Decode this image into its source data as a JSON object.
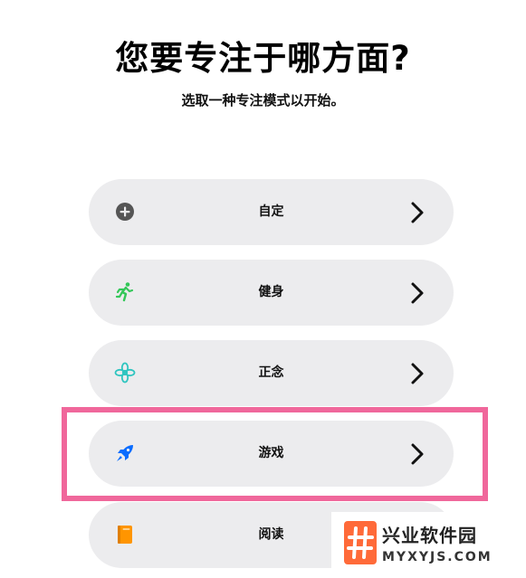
{
  "header": {
    "title": "您要专注于哪方面?",
    "subtitle": "选取一种专注模式以开始。"
  },
  "options": [
    {
      "label": "自定",
      "icon": "plus-circle-icon",
      "color": "#555555"
    },
    {
      "label": "健身",
      "icon": "running-figure-icon",
      "color": "#34c759"
    },
    {
      "label": "正念",
      "icon": "flower-icon",
      "color": "#30c5c0"
    },
    {
      "label": "游戏",
      "icon": "rocket-icon",
      "color": "#0a6cff"
    },
    {
      "label": "阅读",
      "icon": "book-icon",
      "color": "#ff9500"
    }
  ],
  "highlight_color": "#f0679b",
  "watermark": {
    "name": "兴业软件园",
    "domain": "MYXYJS.COM",
    "logo_color": "#ff6a39"
  }
}
